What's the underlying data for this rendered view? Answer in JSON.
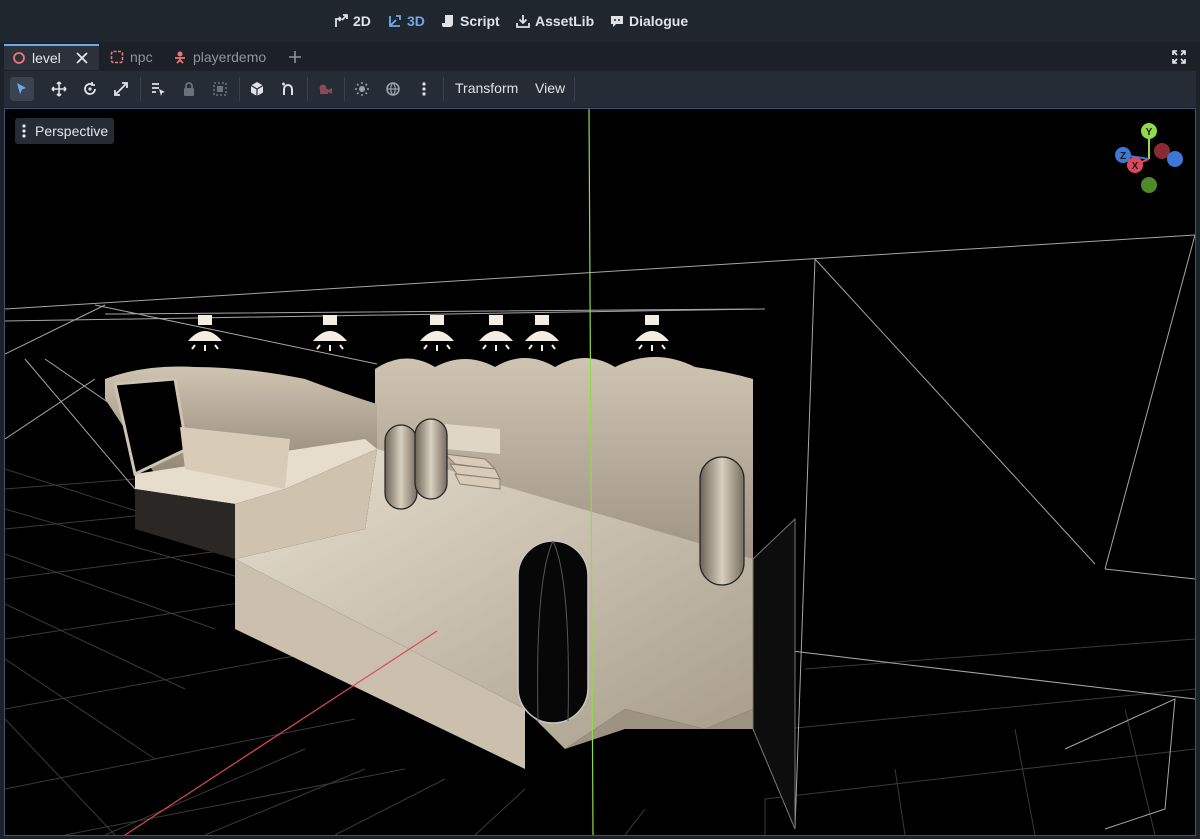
{
  "workspaces": [
    {
      "label": "2D",
      "icon": "2d-icon"
    },
    {
      "label": "3D",
      "icon": "3d-icon",
      "active": true
    },
    {
      "label": "Script",
      "icon": "script-icon"
    },
    {
      "label": "AssetLib",
      "icon": "assetlib-icon"
    },
    {
      "label": "Dialogue",
      "icon": "dialogue-icon"
    }
  ],
  "scene_tabs": [
    {
      "label": "level",
      "icon": "node3d-circle-icon",
      "active": true
    },
    {
      "label": "npc",
      "icon": "control-node-icon"
    },
    {
      "label": "playerdemo",
      "icon": "character-node-icon"
    }
  ],
  "toolbar": {
    "tools": [
      "select-tool-icon",
      "move-tool-icon",
      "rotate-tool-icon",
      "scale-tool-icon",
      "list-select-icon",
      "lock-icon",
      "group-icon",
      "local-space-icon",
      "snap-icon",
      "camera-preview-icon",
      "sun-preview-icon",
      "environment-preview-icon",
      "more-options-icon"
    ],
    "transform_label": "Transform",
    "view_label": "View"
  },
  "viewport": {
    "perspective_label": "Perspective",
    "gizmo_axes": {
      "y": "Y",
      "z": "Z",
      "x": "X"
    }
  },
  "colors": {
    "accent": "#6fa8ea",
    "x_axis": "#e0475c",
    "y_axis": "#8fdb4a",
    "z_axis": "#3d78d6",
    "floor_light": "#e8e0d0"
  }
}
